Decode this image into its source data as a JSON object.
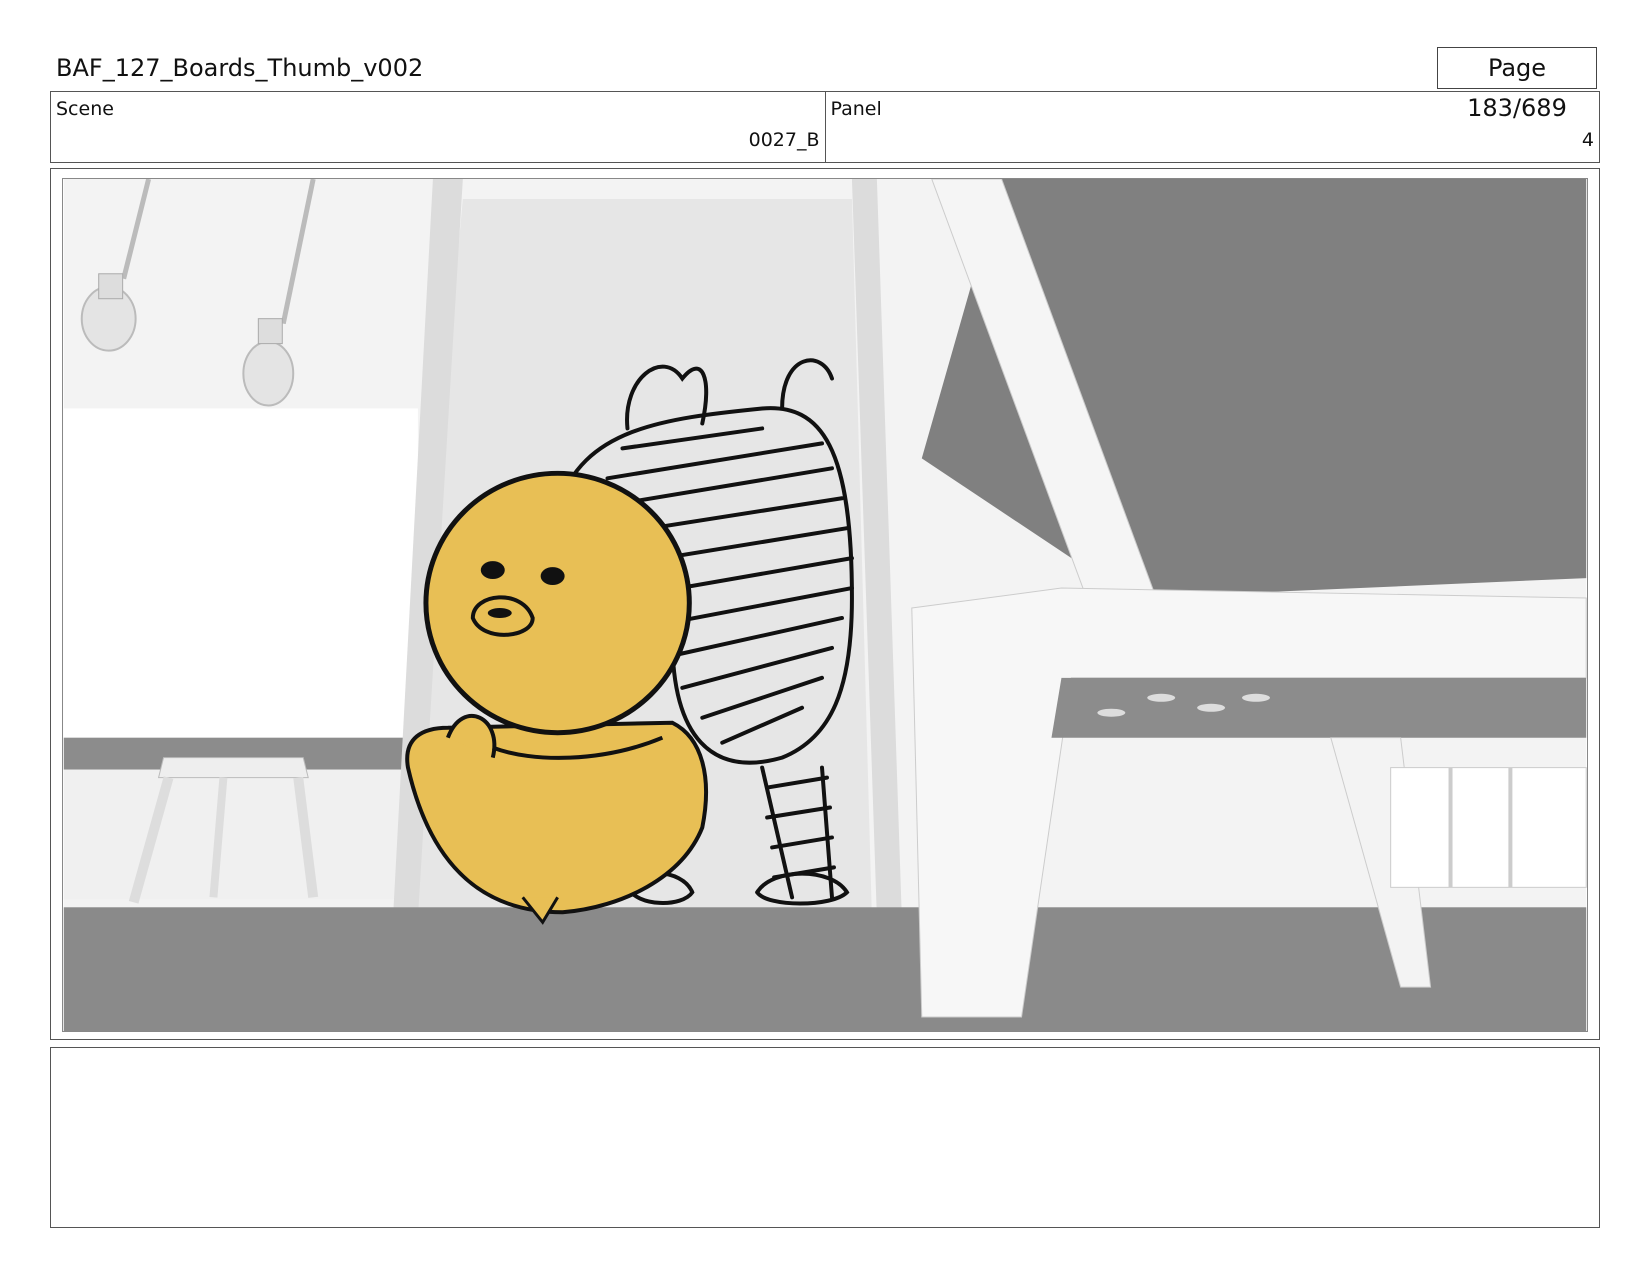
{
  "header": {
    "title": "BAF_127_Boards_Thumb_v002",
    "page": "Page 183/689"
  },
  "info": {
    "scene_label": "Scene",
    "scene_value": "0027_B",
    "panel_label": "Panel",
    "panel_value": "4"
  },
  "notes": {
    "text": ""
  },
  "colors": {
    "character_fill": "#e8bf55",
    "floor": "#8a8a8a",
    "ceiling_dark": "#808080"
  }
}
